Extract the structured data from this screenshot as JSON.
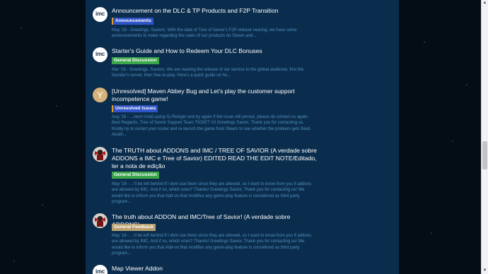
{
  "topics": [
    {
      "title": "Announcement on the DLC & TP Products and F2P Transition",
      "tag": "Announcements",
      "excerpt": "May '16 - Greetings, Saviors. With the date of Tree of Savior's F2P release nearing, we have some announcements to make regarding the sales of our products on Steam and..."
    },
    {
      "title": "Starter's Guide and How to Redeem Your DLC Bonuses",
      "tag": "General Discussion",
      "excerpt": "Mar '16 - Greetings, Saviors. We are nearing the release of our service to the global audience, first the founder's server, then free-to-play. Here's a quick guide on ho..."
    },
    {
      "title": "[Unresolved] Maven Abbey Bug and Let's play the customer support incompetence game!",
      "tag": "Unresolved Issues",
      "avatar_letter": "Y",
      "excerpt": "Aug '16 - ...stem Unit(Laptop 5) Relogin and try again If the issue still persist, please do contact us again. Best Regards, Tree of Savior Support Team TICKET #3 Greetings Savior, Thank you for contacting us. Kindly try to restart your router and re-launch the game from Steam to see whether the problem gets fixed. Anoth..."
    },
    {
      "title": "The TRUTH about ADDONS and IMC / TREE OF SAVIOR (A verdade sobre ADDONS a IMC e Tree of Savior) EDITED READ THE EDIT NOTE/Editado, ler a nota de edição",
      "tag": "General Discussion",
      "excerpt": "May '16 - ...'ll be left behind if I dont use them since they are allowed, so I want to know from you if addons are allowed by IMC. And if so, which ones? Thanks! Greetings Savior, Thank you for contacting us! We would like to inform you that Add-on that modifies any game-play feature is considered as third party program..."
    },
    {
      "title": "The truth about ADDON and IMC/Tree of Savior! (A verdade sobre ADDONS)",
      "tag": "General Feedback",
      "excerpt": "May '16 - ...'ll be left behind if I dont use them since they are allowed, so I want to know from you if addons are allowed by IMC. And if so, which ones? Thanks! Greetings Savior, Thank you for contacting us! We would like to inform you that Add-on that modifies any game-play feature is considered as third party program..."
    },
    {
      "title": "Map Viewer Addon"
    }
  ],
  "avatar_text": "imc",
  "colors": {
    "panel": "#0b2d4d",
    "link": "#4f8fbe",
    "tag_announcements": "#2f54c7",
    "tag_general": "#3aa64a",
    "tag_feedback": "#b9a06f"
  }
}
